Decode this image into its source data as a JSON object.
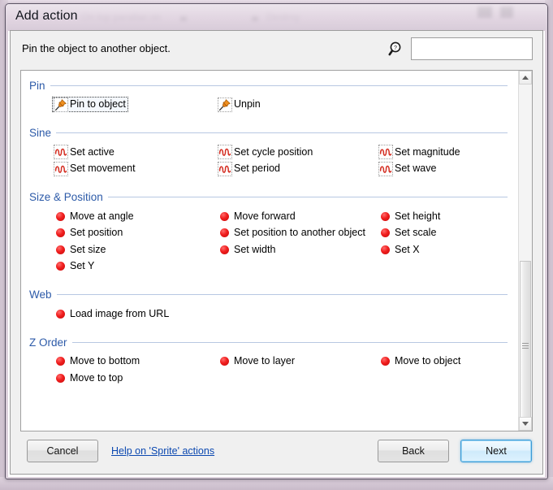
{
  "window": {
    "title": "Add action",
    "backdrop_fragments": [
      "On top parallax on",
      "Destroy"
    ]
  },
  "header": {
    "description": "Pin the object to another object.",
    "search": {
      "icon": "search-help-icon",
      "value": "",
      "placeholder": ""
    }
  },
  "colors": {
    "section_title": "#2c5aa8",
    "section_rule": "#b8c8e2",
    "accent_default_button": "#3c9ad6",
    "link": "#0b48b0",
    "red_dot": "#f01d1d",
    "pin_orange": "#e8821a",
    "sine_red": "#d42e22",
    "titlebar": "#ddd0dd"
  },
  "list": {
    "sections": [
      {
        "title": "Pin",
        "icon_type": "pin-icon",
        "rows": [
          [
            {
              "label": "Pin to object",
              "selected": true
            },
            {
              "label": "Unpin",
              "selected": false
            }
          ]
        ]
      },
      {
        "title": "Sine",
        "icon_type": "sine-icon",
        "rows": [
          [
            {
              "label": "Set active",
              "selected": false
            },
            {
              "label": "Set cycle position",
              "selected": false
            },
            {
              "label": "Set magnitude",
              "selected": false
            }
          ],
          [
            {
              "label": "Set movement",
              "selected": false
            },
            {
              "label": "Set period",
              "selected": false
            },
            {
              "label": "Set wave",
              "selected": false
            }
          ]
        ]
      },
      {
        "title": "Size & Position",
        "icon_type": "red-dot-icon",
        "rows": [
          [
            {
              "label": "Move at angle",
              "selected": false
            },
            {
              "label": "Move forward",
              "selected": false
            },
            {
              "label": "Set height",
              "selected": false
            }
          ],
          [
            {
              "label": "Set position",
              "selected": false
            },
            {
              "label": "Set position to another object",
              "selected": false
            },
            {
              "label": "Set scale",
              "selected": false
            }
          ],
          [
            {
              "label": "Set size",
              "selected": false
            },
            {
              "label": "Set width",
              "selected": false
            },
            {
              "label": "Set X",
              "selected": false
            }
          ],
          [
            {
              "label": "Set Y",
              "selected": false
            }
          ]
        ]
      },
      {
        "title": "Web",
        "icon_type": "red-dot-icon",
        "rows": [
          [
            {
              "label": "Load image from URL",
              "selected": false
            }
          ]
        ]
      },
      {
        "title": "Z Order",
        "icon_type": "red-dot-icon",
        "rows": [
          [
            {
              "label": "Move to bottom",
              "selected": false
            },
            {
              "label": "Move to layer",
              "selected": false
            },
            {
              "label": "Move to object",
              "selected": false
            }
          ],
          [
            {
              "label": "Move to top",
              "selected": false
            }
          ]
        ]
      }
    ]
  },
  "scrollbar": {
    "up_arrow": "scroll-up-icon",
    "down_arrow": "scroll-down-icon"
  },
  "footer": {
    "cancel_label": "Cancel",
    "help_link_label": "Help on 'Sprite' actions",
    "back_label": "Back",
    "next_label": "Next"
  }
}
